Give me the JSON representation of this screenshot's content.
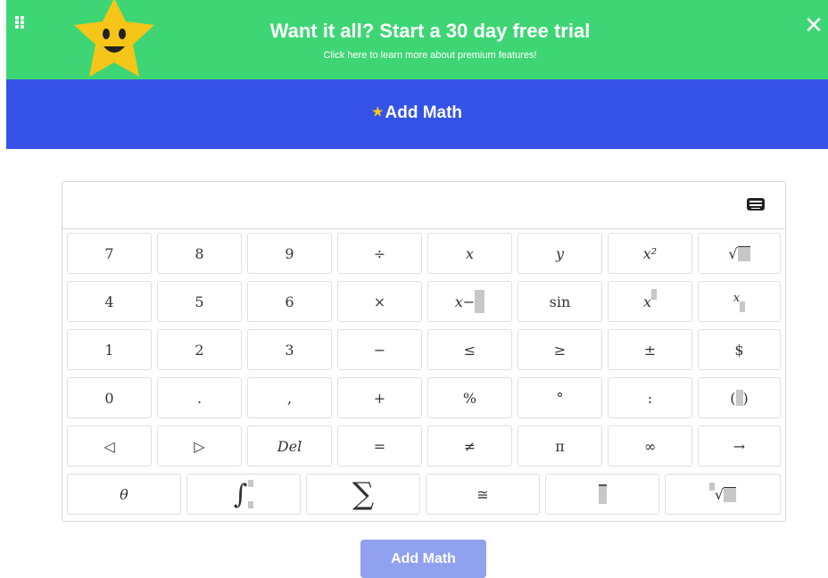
{
  "promo": {
    "title": "Want it all? Start a 30 day free trial",
    "subtitle": "Click here to learn more about premium features!",
    "close": "✕"
  },
  "header": {
    "title": "Add Math"
  },
  "keypad": {
    "rows": [
      [
        "7",
        "8",
        "9",
        "÷",
        "x",
        "y",
        "x²",
        "√"
      ],
      [
        "4",
        "5",
        "6",
        "×",
        "x−",
        "sin",
        "x^",
        "x_"
      ],
      [
        "1",
        "2",
        "3",
        "−",
        "≤",
        "≥",
        "±",
        "$"
      ],
      [
        "0",
        ".",
        ",",
        "+",
        "%",
        "°",
        ":",
        "( )"
      ],
      [
        "◁",
        "▷",
        "Del",
        "=",
        "≠",
        "π",
        "∞",
        "→"
      ],
      [
        "θ",
        "∫",
        "∑",
        "≅",
        "overline",
        "ⁿ√"
      ]
    ]
  },
  "footer": {
    "add_button": "Add Math"
  },
  "colors": {
    "promo_bg": "#3ed674",
    "header_bg": "#3453e6",
    "button_bg": "#8fa1ef",
    "star": "#f5c518"
  },
  "icons": {
    "menu": "grip-icon",
    "mascot": "star-mascot-icon",
    "keyboard": "keyboard-icon"
  }
}
